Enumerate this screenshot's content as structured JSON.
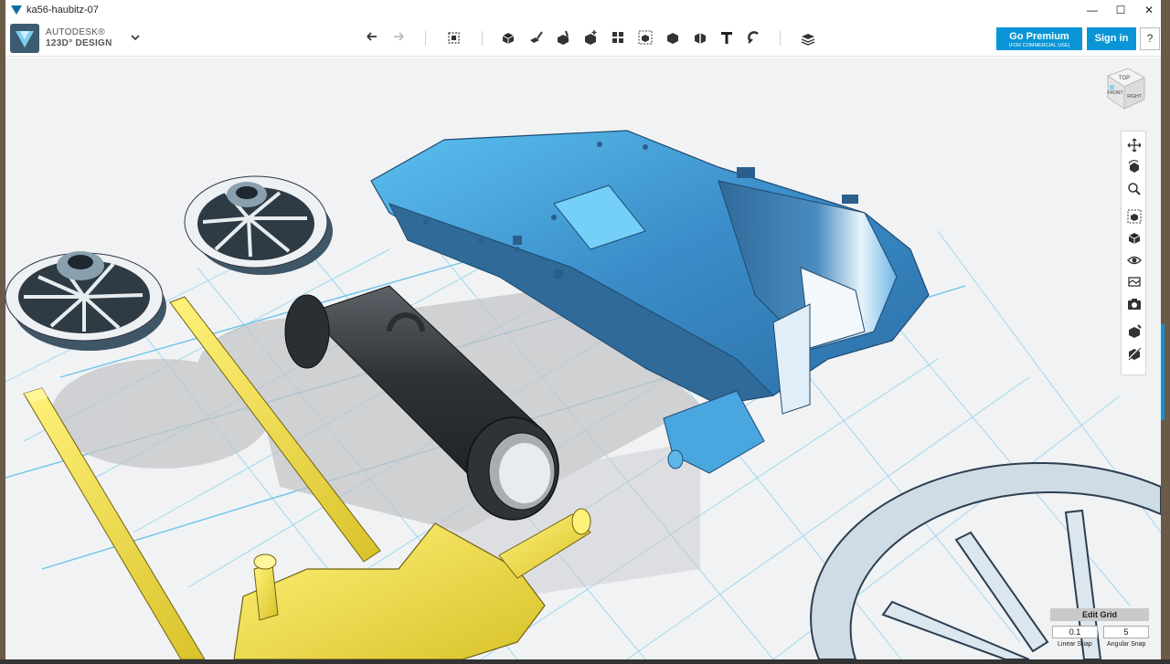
{
  "window": {
    "title": "ka56-haubitz-07",
    "minimize": "—",
    "maximize": "☐",
    "close": "✕"
  },
  "brand": {
    "line1": "AUTODESK®",
    "line2": "123D° DESIGN"
  },
  "toolbar": {
    "icons": [
      "undo-icon",
      "redo-icon",
      "transform-icon",
      "primitives-icon",
      "sketch-icon",
      "construct-icon",
      "modify-icon",
      "pattern-icon",
      "grouping-icon",
      "combine-icon",
      "measure-icon",
      "text-icon",
      "snap-icon",
      "material-icon"
    ]
  },
  "actions": {
    "premium_label": "Go Premium",
    "premium_sub": "(FOR COMMERCIAL USE)",
    "signin_label": "Sign in",
    "help_label": "?"
  },
  "viewcube": {
    "top": "TOP",
    "front": "FRONT",
    "right": "RIGHT"
  },
  "grid": {
    "title": "Edit Grid",
    "linear_value": "0.1",
    "angular_value": "5",
    "linear_label": "Linear Snap",
    "angular_label": "Angular Snap"
  },
  "colors": {
    "accent": "#0a96d6",
    "carriage": "#3a9ad8",
    "barrel": "#3a3f44",
    "brass": "#f0e050",
    "grid_line": "#8fd2ee"
  }
}
